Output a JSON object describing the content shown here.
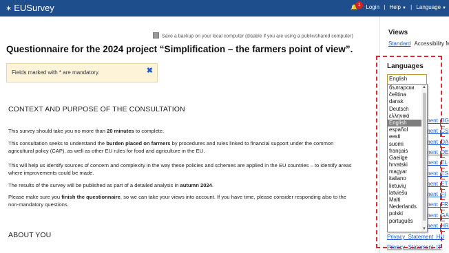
{
  "header": {
    "logo_text": "EUSurvey",
    "notifications_count": "1",
    "login": "Login",
    "help": "Help",
    "language": "Language"
  },
  "backup_label": "Save a backup on your local computer (disable if you are using a public/shared computer)",
  "title": "Questionnaire for the 2024 project “Simplification – the farmers point of view”.",
  "alert": {
    "text": "Fields marked with * are mandatory."
  },
  "context": {
    "heading": "CONTEXT AND PURPOSE OF THE CONSULTATION",
    "p1_a": "This survey should take you no more than ",
    "p1_b": "20 minutes",
    "p1_c": " to complete.",
    "p2_a": "This consultation seeks to understand the ",
    "p2_b": "burden placed on farmers",
    "p2_c": " by procedures and rules linked to financial support under the common agricultural policy (CAP), as well as other EU rules for food and agriculture in the EU.",
    "p3": "This will help us identify sources of concern and complexity in the way these policies and schemes are applied in the EU countries – to identify areas where improvements could be made.",
    "p4_a": "The results of the survey will be published as part of a detailed analysis in ",
    "p4_b": "autumn 2024",
    "p4_c": ".",
    "p5_a": "Please make sure you ",
    "p5_b": "finish the questionnaire",
    "p5_c": ", so we can take your views into account. If you have time, please consider responding also to the non-mandatory questions."
  },
  "about": {
    "heading": "ABOUT YOU"
  },
  "sidebar": {
    "views_heading": "Views",
    "views_standard": "Standard",
    "views_accessibility": "Accessibility M",
    "languages_heading": "Languages",
    "selected_language": "English",
    "language_options": [
      "български",
      "čeština",
      "dansk",
      "Deutsch",
      "ελληνικά",
      "English",
      "español",
      "eesti",
      "suomi",
      "français",
      "Gaeilge",
      "hrvatski",
      "magyar",
      "italiano",
      "lietuvių",
      "latviešu",
      "Malti",
      "Nederlands",
      "polski",
      "português"
    ],
    "privacy_links": [
      "ment_BG",
      "ment_CS",
      "ment_DA",
      "ment_DE",
      "ment_EL",
      "ment_ES",
      "ment_ET",
      "ment_FI",
      "ment_FR",
      "ment_GA",
      "ment_HR"
    ],
    "privacy_hu": "Privacy_Statement_HU",
    "privacy_it": "Privacy_Statement_IT"
  }
}
